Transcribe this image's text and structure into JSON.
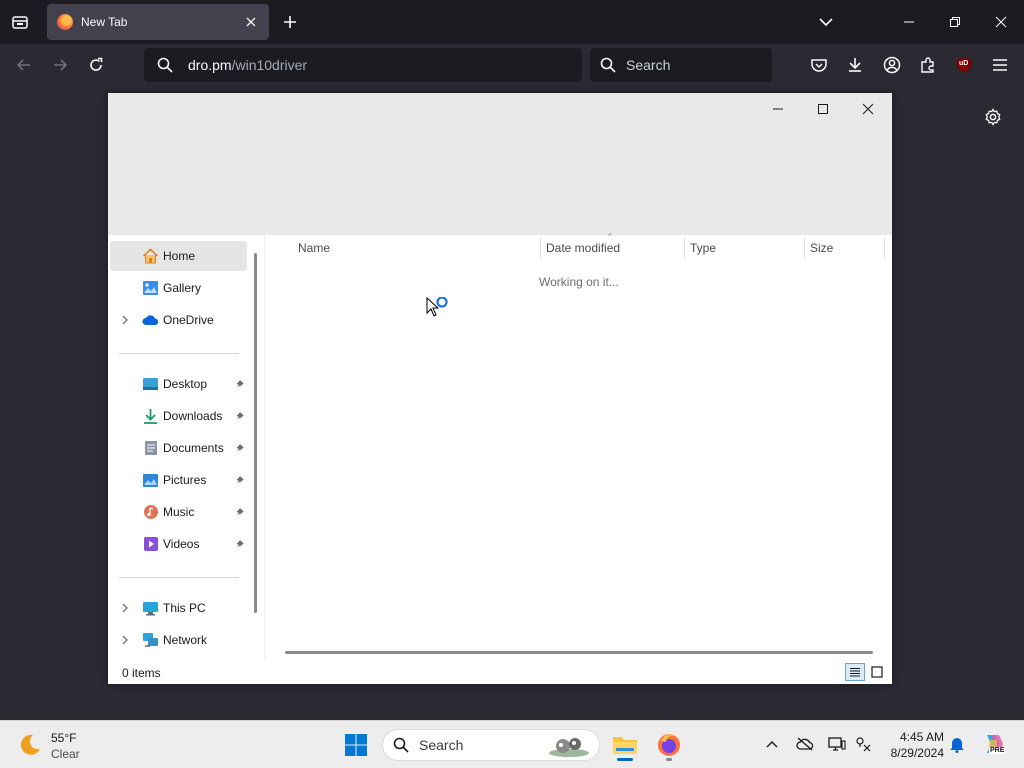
{
  "browser": {
    "tab_title": "New Tab",
    "url_host": "dro.pm",
    "url_path": "/win10driver",
    "search_placeholder": "Search",
    "ublock_badge": "uD"
  },
  "dialog": {
    "nav": {
      "home": "Home",
      "gallery": "Gallery",
      "onedrive": "OneDrive",
      "desktop": "Desktop",
      "downloads": "Downloads",
      "documents": "Documents",
      "pictures": "Pictures",
      "music": "Music",
      "videos": "Videos",
      "this_pc": "This PC",
      "network": "Network"
    },
    "columns": {
      "name": "Name",
      "date_modified": "Date modified",
      "type": "Type",
      "size": "Size"
    },
    "working_text": "Working on it...",
    "status": "0 items"
  },
  "taskbar": {
    "weather_temp": "55°F",
    "weather_cond": "Clear",
    "search_placeholder": "Search",
    "time": "4:45 AM",
    "date": "8/29/2024",
    "copilot_badge": "PRE"
  },
  "colors": {
    "browser_bg": "#2b2a33",
    "tabbar_bg": "#1c1b22",
    "accent_blue": "#0067c0"
  }
}
